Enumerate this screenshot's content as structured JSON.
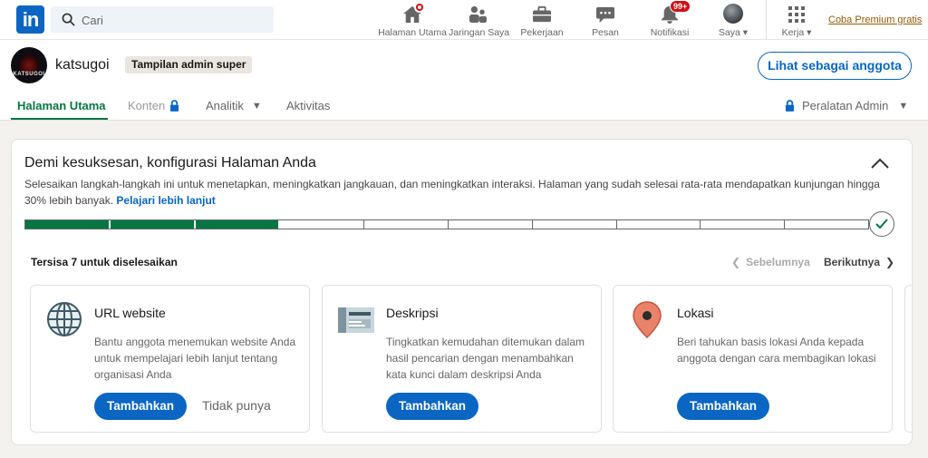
{
  "nav": {
    "logo_text": "in",
    "search_placeholder": "Cari",
    "items": [
      {
        "label": "Halaman Utama",
        "icon": "home-icon"
      },
      {
        "label": "Jaringan Saya",
        "icon": "people-icon"
      },
      {
        "label": "Pekerjaan",
        "icon": "briefcase-icon"
      },
      {
        "label": "Pesan",
        "icon": "message-icon"
      },
      {
        "label": "Notifikasi",
        "icon": "bell-icon",
        "badge": "99+"
      },
      {
        "label": "Saya",
        "icon": "avatar"
      },
      {
        "label": "Kerja",
        "icon": "grid-icon"
      }
    ],
    "premium_link": "Coba Premium gratis"
  },
  "admin": {
    "page_name": "katsugoi",
    "logo_text": "KATSUGOI",
    "admin_badge": "Tampilan admin super",
    "view_as_member": "Lihat sebagai anggota",
    "tabs": [
      {
        "label": "Halaman Utama"
      },
      {
        "label": "Konten"
      },
      {
        "label": "Analitik"
      },
      {
        "label": "Aktivitas"
      }
    ],
    "admin_tools": "Peralatan Admin"
  },
  "setup": {
    "title": "Demi kesuksesan, konfigurasi Halaman Anda",
    "description": "Selesaikan langkah-langkah ini untuk menetapkan, meningkatkan jangkauan, dan meningkatkan interaksi. Halaman yang sudah selesai rata-rata mendapatkan kunjungan hingga 30% lebih banyak.",
    "learn_more": "Pelajari lebih lanjut",
    "progress": {
      "completed": 3,
      "total": 10
    },
    "remaining": "Tersisa 7 untuk diselesaikan",
    "prev": "Sebelumnya",
    "next": "Berikutnya",
    "tasks": [
      {
        "title": "URL website",
        "desc": "Bantu anggota menemukan website Anda untuk mempelajari lebih lanjut tentang organisasi Anda",
        "add": "Tambahkan",
        "skip": "Tidak punya",
        "icon": "globe-icon"
      },
      {
        "title": "Deskripsi",
        "desc": "Tingkatkan kemudahan ditemukan dalam hasil pencarian dengan menambahkan kata kunci dalam deskripsi Anda",
        "add": "Tambahkan",
        "icon": "document-icon"
      },
      {
        "title": "Lokasi",
        "desc": "Beri tahukan basis lokasi Anda kepada anggota dengan cara membagikan lokasi",
        "add": "Tambahkan",
        "icon": "location-pin-icon"
      }
    ]
  },
  "colors": {
    "brand": "#0a66c2",
    "success": "#057642",
    "notification": "#cc1016",
    "premium": "#915907"
  }
}
